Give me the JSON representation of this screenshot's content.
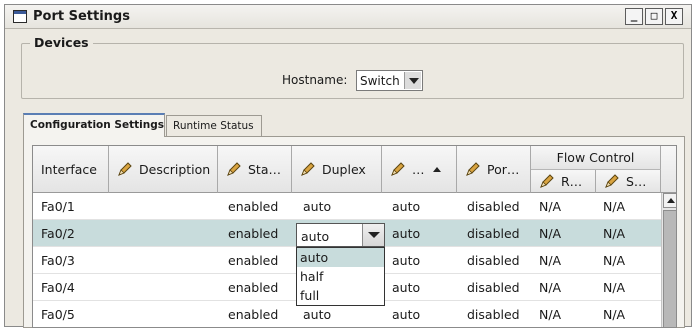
{
  "window": {
    "title": "Port Settings",
    "buttons": [
      "_",
      "□",
      "X"
    ]
  },
  "devices": {
    "legend": "Devices",
    "hostname_label": "Hostname:",
    "hostname_value": "Switch"
  },
  "tabs": [
    {
      "label": "Configuration Settings",
      "active": true
    },
    {
      "label": "Runtime Status",
      "active": false
    }
  ],
  "table": {
    "headers": {
      "interface": "Interface",
      "description": "Description",
      "status": "Sta…",
      "duplex": "Duplex",
      "speed": "…",
      "port": "Por…",
      "flow_control": "Flow Control",
      "flow_r": "R…",
      "flow_s": "S…"
    },
    "rows": [
      {
        "interface": "Fa0/1",
        "description": "",
        "status": "enabled",
        "duplex": "auto",
        "speed": "auto",
        "port": "disabled",
        "flow_r": "N/A",
        "flow_s": "N/A"
      },
      {
        "interface": "Fa0/2",
        "description": "",
        "status": "enabled",
        "duplex": "auto",
        "speed": "auto",
        "port": "disabled",
        "flow_r": "N/A",
        "flow_s": "N/A"
      },
      {
        "interface": "Fa0/3",
        "description": "",
        "status": "enabled",
        "duplex": "",
        "speed": "auto",
        "port": "disabled",
        "flow_r": "N/A",
        "flow_s": "N/A"
      },
      {
        "interface": "Fa0/4",
        "description": "",
        "status": "enabled",
        "duplex": "",
        "speed": "auto",
        "port": "disabled",
        "flow_r": "N/A",
        "flow_s": "N/A"
      },
      {
        "interface": "Fa0/5",
        "description": "",
        "status": "enabled",
        "duplex": "auto",
        "speed": "auto",
        "port": "disabled",
        "flow_r": "N/A",
        "flow_s": "N/A"
      }
    ],
    "selected_row": 1,
    "duplex_options": [
      "auto",
      "half",
      "full"
    ],
    "duplex_highlighted": "auto"
  },
  "colors": {
    "selection": "#c8dcdc",
    "window_bg": "#ece9e1",
    "active_tab_accent": "#5a7eb4"
  },
  "icons": [
    "window-icon",
    "pencil-icon",
    "sort-ascending-icon",
    "dropdown-arrow-icon",
    "scroll-up-arrow-icon"
  ]
}
